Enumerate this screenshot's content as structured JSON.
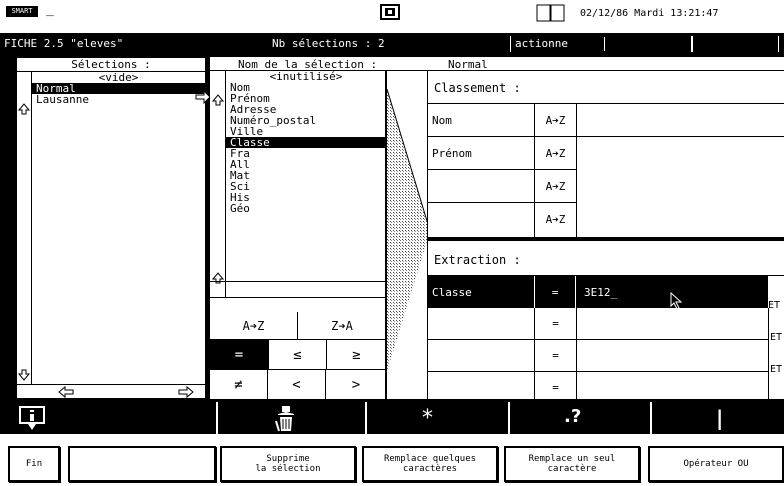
{
  "system": {
    "logo": "SMART",
    "cursor": "_",
    "clock": "02/12/86 Mardi 13:21:47"
  },
  "titlebar": {
    "file": "FICHE 2.5 \"eleves\"",
    "count": "Nb sélections : 2",
    "mode": "actionne"
  },
  "selections": {
    "header": "Sélections :",
    "items": [
      "<vide>",
      "Normal",
      "Lausanne"
    ],
    "selected": 1
  },
  "selection_name": {
    "label": "Nom de la sélection :",
    "value": "Normal"
  },
  "fields": {
    "items": [
      "<inutilisé>",
      "Nom",
      "Prénom",
      "Adresse",
      "Numéro_postal",
      "Ville",
      "Classe",
      "Fra",
      "All",
      "Mat",
      "Sci",
      "His",
      "Géo"
    ],
    "selected": 6
  },
  "sort_buttons": [
    "A➔Z",
    "Z➔A"
  ],
  "operators": [
    "=",
    "<",
    ">",
    "≠",
    "<",
    ">"
  ],
  "classement": {
    "header": "Classement :",
    "rows": [
      {
        "field": "Nom",
        "order": "A➔Z"
      },
      {
        "field": "Prénom",
        "order": "A➔Z"
      },
      {
        "field": "",
        "order": "A➔Z"
      },
      {
        "field": "",
        "order": "A➔Z"
      }
    ]
  },
  "extraction": {
    "header": "Extraction :",
    "rows": [
      {
        "field": "Classe",
        "op": "=",
        "value": "3E12_",
        "conj": "ET"
      },
      {
        "field": "",
        "op": "=",
        "value": "",
        "conj": "ET"
      },
      {
        "field": "",
        "op": "=",
        "value": "",
        "conj": "ET"
      },
      {
        "field": "",
        "op": "=",
        "value": "",
        "conj": ""
      }
    ]
  },
  "toolbar": {
    "star": "*",
    "help": ".?",
    "bar": "|"
  },
  "fkeys": [
    "Fin",
    "",
    "Supprime\nla sélection",
    "Remplace quelques\ncaractères",
    "Remplace un seul\ncaractère",
    "Opérateur OU"
  ]
}
